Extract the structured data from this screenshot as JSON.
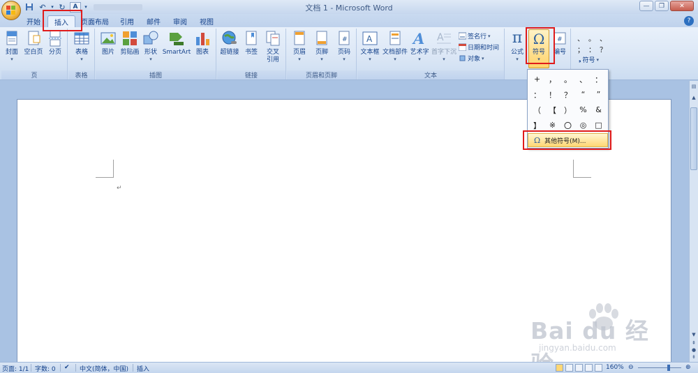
{
  "window": {
    "title": "文档 1 - Microsoft Word"
  },
  "quick_access": [
    "save-icon",
    "undo-icon",
    "redo-icon",
    "spelling-icon"
  ],
  "tabs": [
    {
      "label": "开始",
      "active": false
    },
    {
      "label": "插入",
      "active": true
    },
    {
      "label": "页面布局",
      "active": false
    },
    {
      "label": "引用",
      "active": false
    },
    {
      "label": "邮件",
      "active": false
    },
    {
      "label": "审阅",
      "active": false
    },
    {
      "label": "视图",
      "active": false
    }
  ],
  "ribbon": {
    "pages": {
      "label": "页",
      "buttons": [
        "封面",
        "空白页",
        "分页"
      ]
    },
    "tables": {
      "label": "表格",
      "buttons": [
        "表格"
      ]
    },
    "illustrations": {
      "label": "插图",
      "buttons": [
        "图片",
        "剪贴画",
        "形状",
        "SmartArt",
        "图表"
      ]
    },
    "links": {
      "label": "链接",
      "buttons": [
        "超链接",
        "书签",
        "交叉",
        "引用"
      ]
    },
    "header_footer": {
      "label": "页眉和页脚",
      "buttons": [
        "页眉",
        "页脚",
        "页码"
      ]
    },
    "text": {
      "label": "文本",
      "buttons": [
        "文本框",
        "文档部件",
        "艺术字",
        "首字下沉"
      ],
      "small": [
        "签名行",
        "日期和时间",
        "对象"
      ]
    },
    "symbols": {
      "buttons": [
        "公式",
        "符号",
        "编号"
      ],
      "small_symbol": "符号",
      "glyphs": [
        "π",
        "Ω"
      ]
    },
    "special_chars": [
      "、",
      "。",
      "、",
      "；",
      "：",
      "？"
    ]
  },
  "symbol_menu": {
    "symbols": [
      "+",
      "，",
      "。",
      "、",
      "：",
      "：",
      "！",
      "？",
      "“",
      "”",
      "（",
      "【",
      "）",
      "%",
      "&",
      "】",
      "※",
      "〇",
      "◎",
      "□"
    ],
    "more_label": "其他符号(M)..."
  },
  "document": {
    "paragraph_mark": "↵"
  },
  "status": {
    "page": "页面: 1/1",
    "words": "字数: 0",
    "language": "中文(简体，中国)",
    "mode": "插入",
    "zoom": "160%"
  },
  "watermark": {
    "brand": "Bai du 经验",
    "url": "jingyan.baidu.com"
  },
  "colors": {
    "ribbon": "#dae6f5",
    "accent": "#15428b",
    "highlight": "#e01b1b"
  }
}
